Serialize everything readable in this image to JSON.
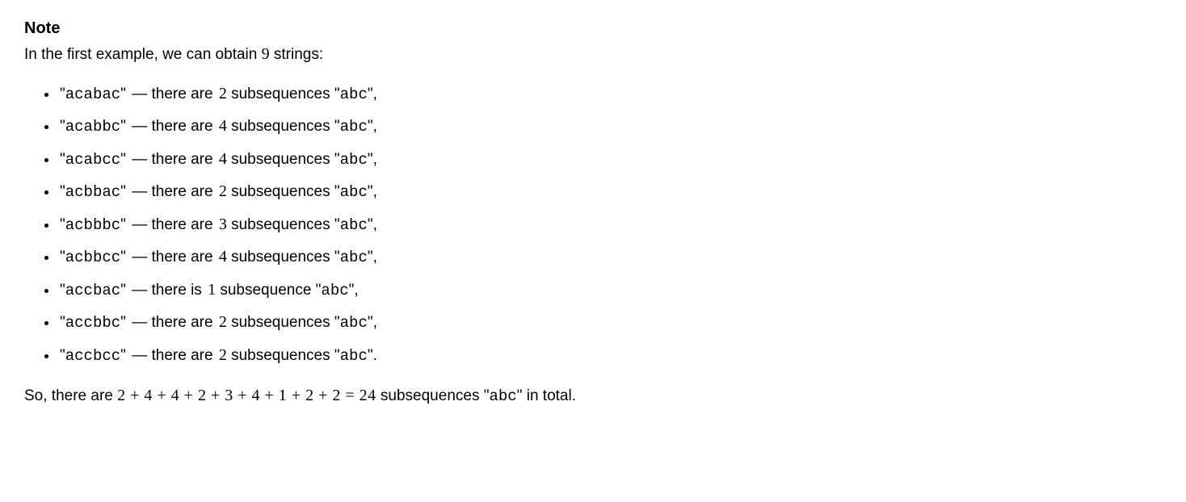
{
  "note_title": "Note",
  "intro_prefix": "In the first example, we can obtain ",
  "intro_count": "9",
  "intro_suffix": " strings:",
  "item_phrase_plural": " — there are ",
  "item_phrase_singular": " — there is ",
  "item_mid_plural": " subsequences ",
  "item_mid_singular": " subsequence ",
  "abc_code": "abc",
  "quote": "\"",
  "items": [
    {
      "str": "acabac",
      "count": "2",
      "singular": false,
      "terminator": ","
    },
    {
      "str": "acabbc",
      "count": "4",
      "singular": false,
      "terminator": ","
    },
    {
      "str": "acabcc",
      "count": "4",
      "singular": false,
      "terminator": ","
    },
    {
      "str": "acbbac",
      "count": "2",
      "singular": false,
      "terminator": ","
    },
    {
      "str": "acbbbc",
      "count": "3",
      "singular": false,
      "terminator": ","
    },
    {
      "str": "acbbcc",
      "count": "4",
      "singular": false,
      "terminator": ","
    },
    {
      "str": "accbac",
      "count": "1",
      "singular": true,
      "terminator": ","
    },
    {
      "str": "accbbc",
      "count": "2",
      "singular": false,
      "terminator": ","
    },
    {
      "str": "accbcc",
      "count": "2",
      "singular": false,
      "terminator": "."
    }
  ],
  "summary_prefix": "So, there are ",
  "summary_expr": "2 + 4 + 4 + 2 + 3 + 4 + 1 + 2 + 2 = 24",
  "summary_mid": " subsequences ",
  "summary_suffix": " in total."
}
